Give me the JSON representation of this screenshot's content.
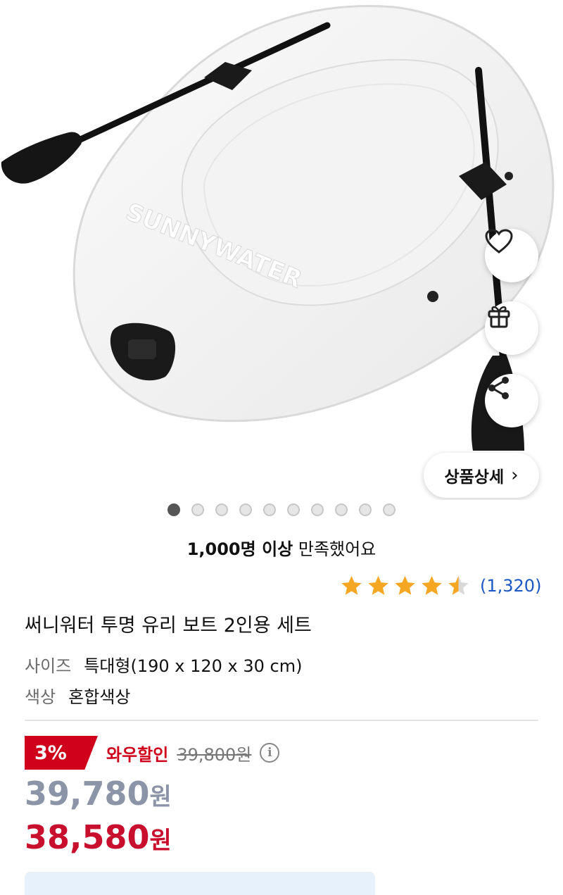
{
  "hero": {
    "brand_text": "SUNNYWATER"
  },
  "actions": {
    "detail_label": "상품상세",
    "detail_chevron": "›"
  },
  "gallery": {
    "total": 10,
    "active_index": 0
  },
  "satisfaction": {
    "bold": "1,000명 이상",
    "rest": " 만족했어요"
  },
  "rating": {
    "stars": 4.5,
    "count": "(1,320)",
    "star_color": "#f5a623"
  },
  "product": {
    "title": "써니워터 투명 유리 보트 2인용 세트",
    "options": [
      {
        "key": "사이즈",
        "value": "특대형(190 x 120 x 30 cm)"
      },
      {
        "key": "색상",
        "value": "혼합색상"
      }
    ]
  },
  "pricing": {
    "discount_badge": "3%",
    "discount_label": "와우할인",
    "original_price": "39,800원",
    "info_icon": "i",
    "price_amount": "39,780",
    "price_unit": "원",
    "wow_price_amount": "38,580",
    "wow_price_unit": "원",
    "accent_red": "#d0021b",
    "gray_price": "#8b95a7"
  }
}
